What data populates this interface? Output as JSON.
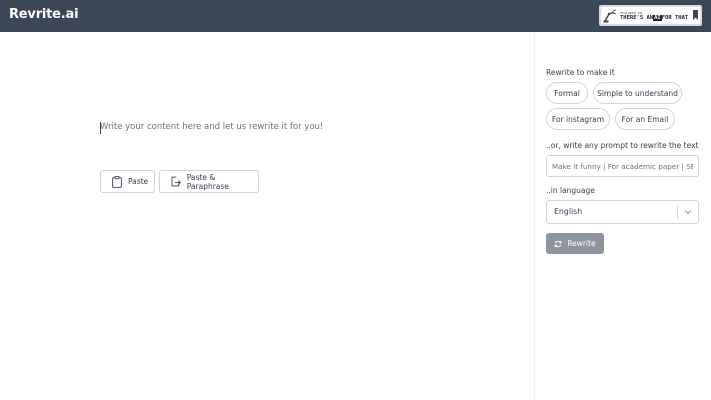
{
  "header": {
    "brand": "Revrite.ai",
    "featured_badge": {
      "small_text": "FEATURED ON",
      "text_before": "THERE'S AN",
      "text_highlight": "AI",
      "text_after": "FOR THAT"
    }
  },
  "editor": {
    "placeholder": "Write your content here and let us rewrite it for you!",
    "paste_label": "Paste",
    "paste_paraphrase_label": "Paste & Paraphrase"
  },
  "panel": {
    "rewrite_heading": "Rewrite to make it",
    "options": [
      "Formal",
      "Simple to understand",
      "For instagram",
      "For an Email"
    ],
    "prompt_label": "..or, write any prompt to rewrite the text",
    "prompt_placeholder": "Make it funny | For academic paper | SEO",
    "language_label": "..in language",
    "language_value": "English",
    "rewrite_button": "Rewrite"
  },
  "colors": {
    "header_bg": "#3b4656",
    "button_disabled": "#8d949e",
    "border": "#d1d5db"
  }
}
